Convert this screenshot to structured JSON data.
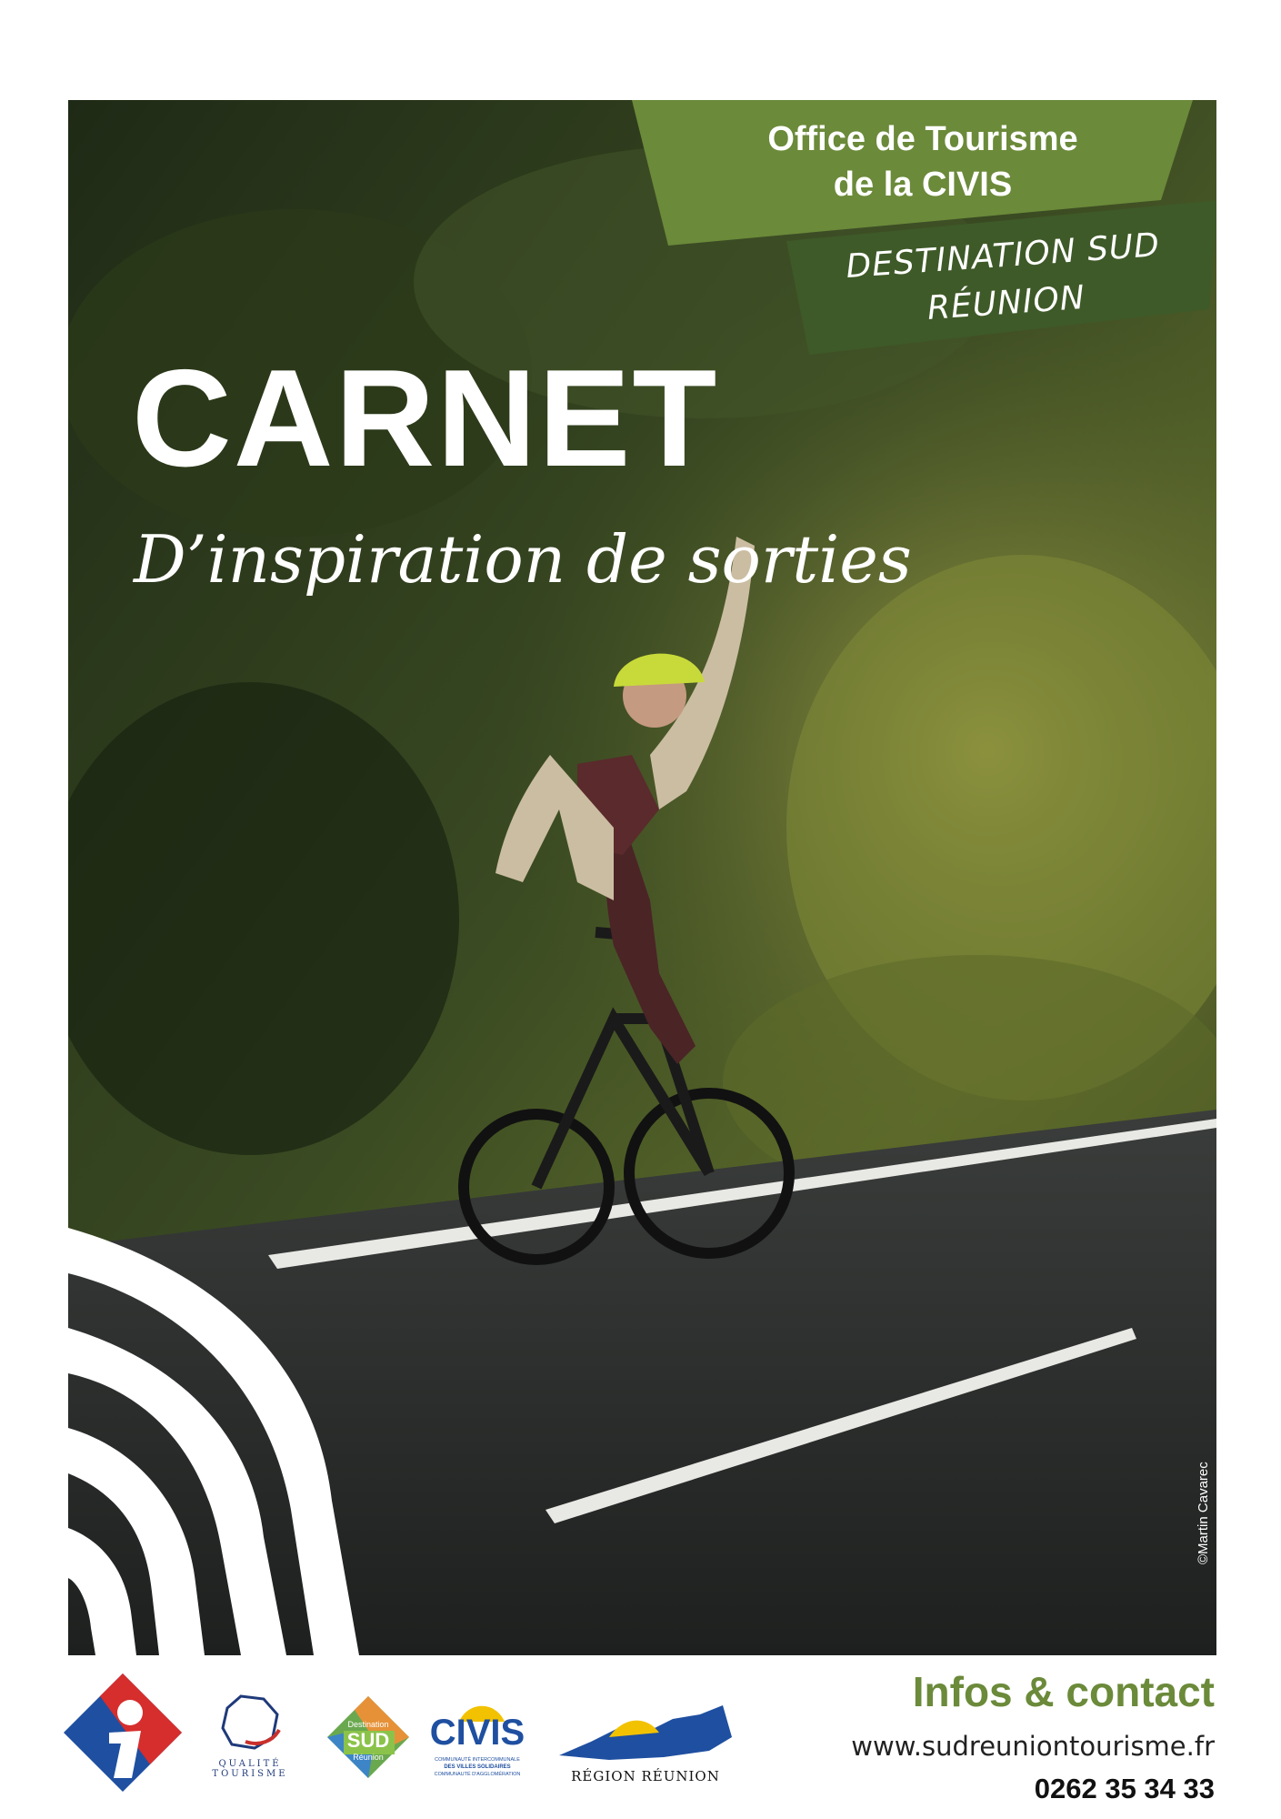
{
  "banner": {
    "office_line1": "Office de Tourisme",
    "office_line2": "de la CIVIS",
    "destination_line1": "DESTINATION SUD",
    "destination_line2": "RÉUNION"
  },
  "cover": {
    "title": "CARNET",
    "subtitle": "D’inspiration de sorties",
    "photo_credit": "©Martin Cavarec"
  },
  "logos": {
    "qualite_line": "QUALITÉ",
    "tourisme_line": "TOURISME",
    "destination_word": "Destination",
    "sud_word": "SUD",
    "reunion_word": "Réunion",
    "civis_word": "CIVIS",
    "civis_caption1": "COMMUNAUTÉ INTERCOMMUNALE",
    "civis_caption2": "DES VILLES SOLIDAIRES",
    "civis_caption3": "COMMUNAUTÉ D'AGGLOMÉRATION",
    "region_caption": "RÉGION RÉUNION"
  },
  "contact": {
    "heading": "Infos & contact",
    "website": "www.sudreuniontourisme.fr",
    "phone": "0262 35 34 33"
  },
  "colors": {
    "green_banner": "#6b8a3a",
    "dark_green_banner": "#3e5a28",
    "contact_green": "#6b8a3a"
  }
}
